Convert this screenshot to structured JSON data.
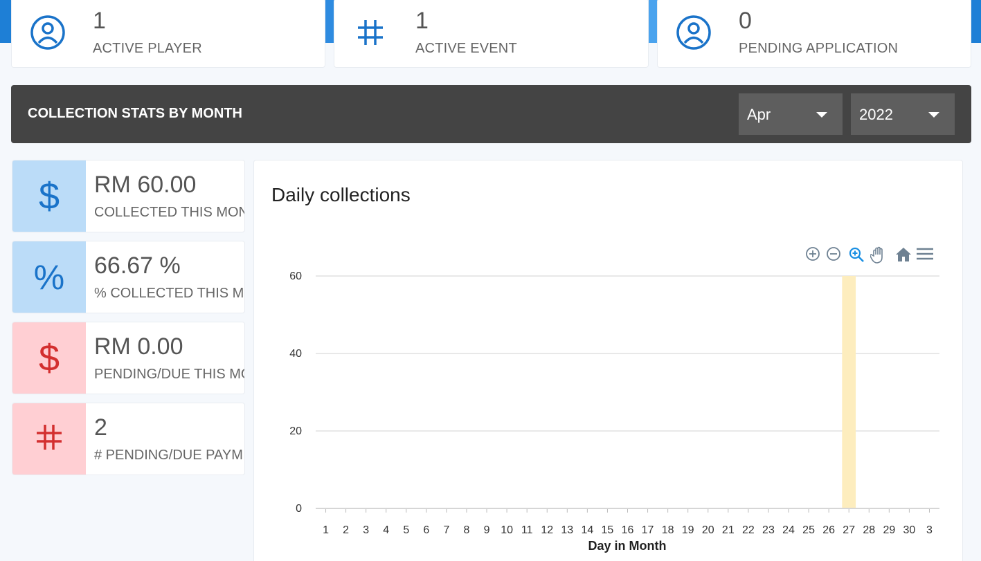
{
  "summary_cards": [
    {
      "value": "1",
      "label": "ACTIVE PLAYER",
      "icon": "user-circle-icon"
    },
    {
      "value": "1",
      "label": "ACTIVE EVENT",
      "icon": "hash-icon"
    },
    {
      "value": "0",
      "label": "PENDING APPLICATION",
      "icon": "user-circle-icon"
    }
  ],
  "collection": {
    "title": "COLLECTION STATS BY MONTH",
    "month": "Apr",
    "year": "2022"
  },
  "stats": [
    {
      "value": "RM 60.00",
      "label": "COLLECTED THIS MON",
      "icon": "dollar-icon",
      "color": "#1a73c9"
    },
    {
      "value": "66.67 %",
      "label": "% COLLECTED THIS MO",
      "icon": "percent-icon",
      "color": "#1a73c9"
    },
    {
      "value": "RM 0.00",
      "label": "PENDING/DUE THIS MO",
      "icon": "dollar-icon",
      "color": "#d32f2f"
    },
    {
      "value": "2",
      "label": "# PENDING/DUE PAYM",
      "icon": "hash-icon",
      "color": "#d32f2f"
    }
  ],
  "chart_data": {
    "type": "bar",
    "title": "Daily collections",
    "xlabel": "Day in Month",
    "ylabel": "",
    "categories": [
      "1",
      "2",
      "3",
      "4",
      "5",
      "6",
      "7",
      "8",
      "9",
      "10",
      "11",
      "12",
      "13",
      "14",
      "15",
      "16",
      "17",
      "18",
      "19",
      "20",
      "21",
      "22",
      "23",
      "24",
      "25",
      "26",
      "27",
      "28",
      "29",
      "30",
      "3"
    ],
    "values": [
      0,
      0,
      0,
      0,
      0,
      0,
      0,
      0,
      0,
      0,
      0,
      0,
      0,
      0,
      0,
      0,
      0,
      0,
      0,
      0,
      0,
      0,
      0,
      0,
      0,
      0,
      60,
      0,
      0,
      0,
      0
    ],
    "ylim": [
      0,
      60
    ],
    "yticks": [
      0,
      20,
      40,
      60
    ],
    "bar_color": "#fdedbe",
    "grid": true
  },
  "colors": {
    "accent_blue": "#1a73c9",
    "accent_red": "#d32f2f",
    "header_bg": "#444444"
  }
}
